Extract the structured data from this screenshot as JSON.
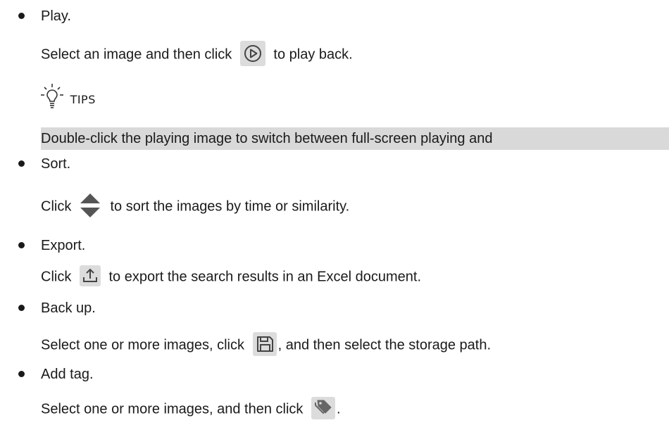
{
  "items": [
    {
      "title": "Play.",
      "desc_before": "Select an image and then click",
      "icon": "play-circle-icon",
      "desc_after": "to play back."
    },
    {
      "title": "Sort.",
      "desc_before": "Click",
      "icon": "sort-arrows-icon",
      "desc_after": "to sort the images by time or similarity."
    },
    {
      "title": "Export.",
      "desc_before": "Click",
      "icon": "export-upload-icon",
      "desc_after": "to export the search results in an Excel document."
    },
    {
      "title": "Back up.",
      "desc_before": "Select one or more images, click",
      "icon": "save-floppy-icon",
      "desc_after": ", and then select the storage path."
    },
    {
      "title": "Add tag.",
      "desc_before": "Select one or more images, and then click",
      "icon": "tag-icon",
      "desc_after": "."
    }
  ],
  "tips": {
    "label": "TIPS",
    "icon": "lightbulb-icon",
    "text": "Double-click the playing image to switch between full-screen playing and"
  },
  "colors": {
    "icon_background": "#dcdcdc",
    "highlight": "#d9d9d9",
    "icon_stroke": "#444444"
  }
}
